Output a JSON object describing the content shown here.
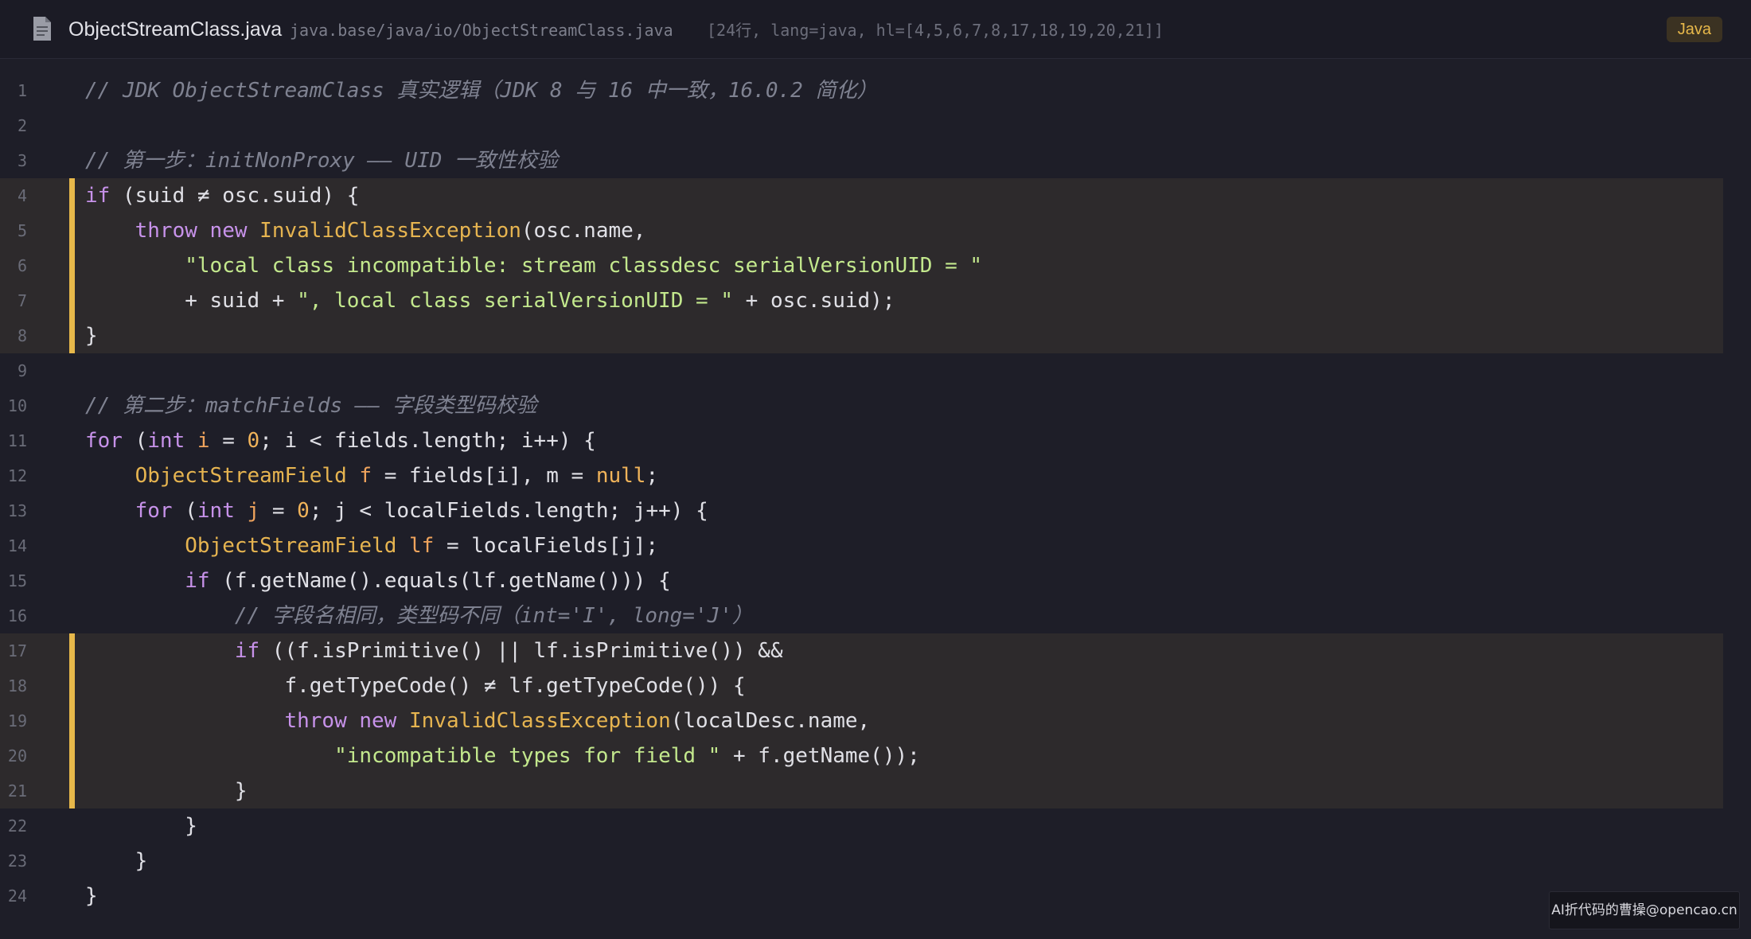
{
  "header": {
    "file_icon": "file-icon",
    "file_name": "ObjectStreamClass.java",
    "file_path": "java.base/java/io/ObjectStreamClass.java",
    "file_meta": "[24行, lang=java, hl=[4,5,6,7,8,17,18,19,20,21]]",
    "language_badge": "Java"
  },
  "colors": {
    "background": "#1e1e28",
    "highlight_background": "#2d2a2c",
    "highlight_accent": "#e7b84a",
    "keyword": "#c792ea",
    "class_name": "#e6b450",
    "string": "#c3e88d",
    "comment": "#7f8291"
  },
  "highlighted_lines": [
    4,
    5,
    6,
    7,
    8,
    17,
    18,
    19,
    20,
    21
  ],
  "lines": [
    {
      "n": "1",
      "tokens": [
        [
          "cmt",
          "// JDK ObjectStreamClass 真实逻辑（JDK 8 与 16 中一致，16.0.2 简化）"
        ]
      ]
    },
    {
      "n": "2",
      "tokens": []
    },
    {
      "n": "3",
      "tokens": [
        [
          "cmt",
          "// 第一步：initNonProxy —— UID 一致性校验"
        ]
      ]
    },
    {
      "n": "4",
      "tokens": [
        [
          "kw",
          "if"
        ],
        [
          "txt",
          " (suid ≠ osc.suid) {"
        ]
      ]
    },
    {
      "n": "5",
      "tokens": [
        [
          "txt",
          "    "
        ],
        [
          "kw",
          "throw new"
        ],
        [
          "txt",
          " "
        ],
        [
          "cls",
          "InvalidClassException"
        ],
        [
          "txt",
          "(osc.name,"
        ]
      ]
    },
    {
      "n": "6",
      "tokens": [
        [
          "txt",
          "        "
        ],
        [
          "str",
          "\"local class incompatible: stream classdesc serialVersionUID = \""
        ]
      ]
    },
    {
      "n": "7",
      "tokens": [
        [
          "txt",
          "        + suid + "
        ],
        [
          "str",
          "\", local class serialVersionUID = \""
        ],
        [
          "txt",
          " + osc.suid);"
        ]
      ]
    },
    {
      "n": "8",
      "tokens": [
        [
          "txt",
          "}"
        ]
      ]
    },
    {
      "n": "9",
      "tokens": []
    },
    {
      "n": "10",
      "tokens": [
        [
          "cmt",
          "// 第二步：matchFields —— 字段类型码校验"
        ]
      ]
    },
    {
      "n": "11",
      "tokens": [
        [
          "kw",
          "for"
        ],
        [
          "txt",
          " ("
        ],
        [
          "kw",
          "int"
        ],
        [
          "txt",
          " "
        ],
        [
          "var",
          "i"
        ],
        [
          "txt",
          " = "
        ],
        [
          "num",
          "0"
        ],
        [
          "txt",
          "; i < fields.length; i++) {"
        ]
      ]
    },
    {
      "n": "12",
      "tokens": [
        [
          "txt",
          "    "
        ],
        [
          "cls",
          "ObjectStreamField"
        ],
        [
          "txt",
          " "
        ],
        [
          "var",
          "f"
        ],
        [
          "txt",
          " = fields[i], m = "
        ],
        [
          "num",
          "null"
        ],
        [
          "txt",
          ";"
        ]
      ]
    },
    {
      "n": "13",
      "tokens": [
        [
          "txt",
          "    "
        ],
        [
          "kw",
          "for"
        ],
        [
          "txt",
          " ("
        ],
        [
          "kw",
          "int"
        ],
        [
          "txt",
          " "
        ],
        [
          "var",
          "j"
        ],
        [
          "txt",
          " = "
        ],
        [
          "num",
          "0"
        ],
        [
          "txt",
          "; j < localFields.length; j++) {"
        ]
      ]
    },
    {
      "n": "14",
      "tokens": [
        [
          "txt",
          "        "
        ],
        [
          "cls",
          "ObjectStreamField"
        ],
        [
          "txt",
          " "
        ],
        [
          "var",
          "lf"
        ],
        [
          "txt",
          " = localFields[j];"
        ]
      ]
    },
    {
      "n": "15",
      "tokens": [
        [
          "txt",
          "        "
        ],
        [
          "kw",
          "if"
        ],
        [
          "txt",
          " (f.getName().equals(lf.getName())) {"
        ]
      ]
    },
    {
      "n": "16",
      "tokens": [
        [
          "txt",
          "            "
        ],
        [
          "cmt",
          "// 字段名相同，类型码不同（int='I', long='J'）"
        ]
      ]
    },
    {
      "n": "17",
      "tokens": [
        [
          "txt",
          "            "
        ],
        [
          "kw",
          "if"
        ],
        [
          "txt",
          " ((f.isPrimitive() || lf.isPrimitive()) &&"
        ]
      ]
    },
    {
      "n": "18",
      "tokens": [
        [
          "txt",
          "                f.getTypeCode() ≠ lf.getTypeCode()) {"
        ]
      ]
    },
    {
      "n": "19",
      "tokens": [
        [
          "txt",
          "                "
        ],
        [
          "kw",
          "throw new"
        ],
        [
          "txt",
          " "
        ],
        [
          "cls",
          "InvalidClassException"
        ],
        [
          "txt",
          "(localDesc.name,"
        ]
      ]
    },
    {
      "n": "20",
      "tokens": [
        [
          "txt",
          "                    "
        ],
        [
          "str",
          "\"incompatible types for field \""
        ],
        [
          "txt",
          " + f.getName());"
        ]
      ]
    },
    {
      "n": "21",
      "tokens": [
        [
          "txt",
          "            }"
        ]
      ]
    },
    {
      "n": "22",
      "tokens": [
        [
          "txt",
          "        }"
        ]
      ]
    },
    {
      "n": "23",
      "tokens": [
        [
          "txt",
          "    }"
        ]
      ]
    },
    {
      "n": "24",
      "tokens": [
        [
          "txt",
          "}"
        ]
      ]
    }
  ],
  "watermark": "AI折代码的曹操@opencao.cn"
}
